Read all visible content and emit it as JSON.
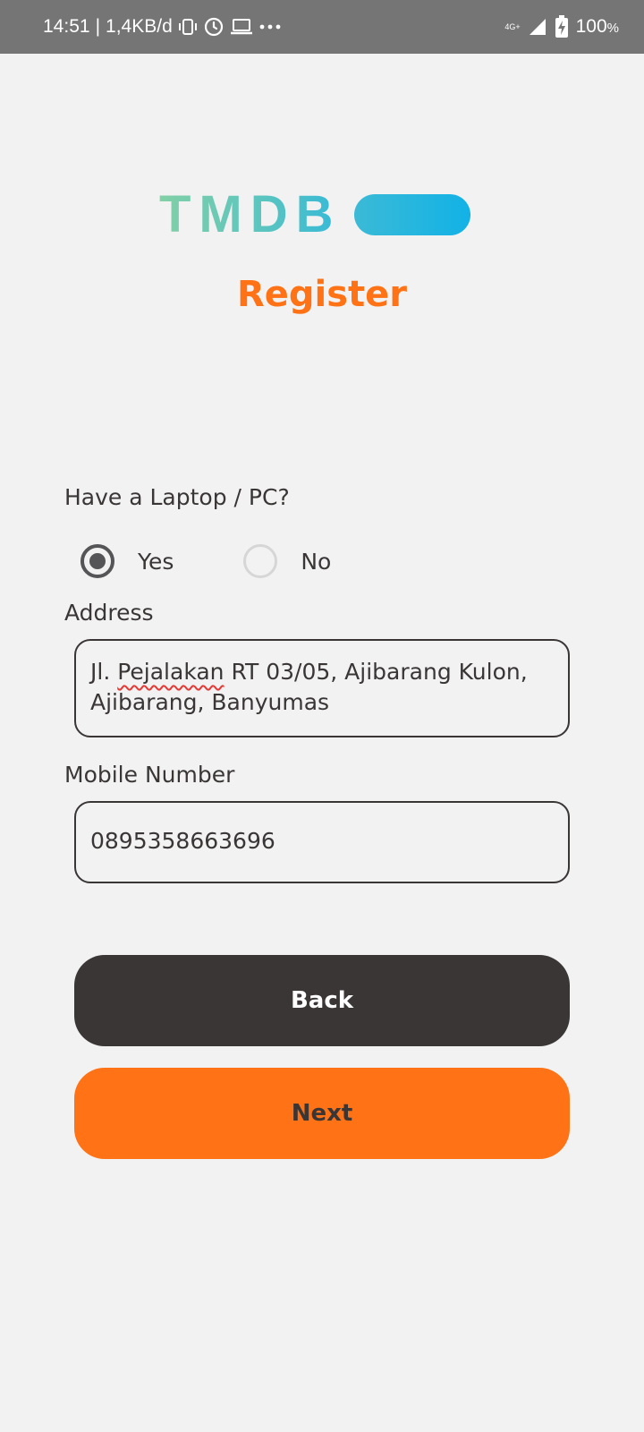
{
  "status_bar": {
    "time": "14:51",
    "separator": "|",
    "speed": "1,4KB/d",
    "network_type": "4G+",
    "battery": "100",
    "battery_unit": "%",
    "icons": [
      "vibrate-icon",
      "alarm-icon",
      "laptop-icon",
      "more-dots-icon",
      "signal-icon",
      "battery-charging-icon"
    ]
  },
  "logo": {
    "text": "TMDB"
  },
  "page": {
    "title": "Register"
  },
  "form": {
    "laptop_question": "Have a Laptop / PC?",
    "radio_options": [
      {
        "label": "Yes",
        "checked": true
      },
      {
        "label": "No",
        "checked": false
      }
    ],
    "address_label": "Address",
    "address_value_prefix": "Jl. ",
    "address_value_misspelled": "Pejalakan",
    "address_value_rest": " RT 03/05, Ajibarang Kulon, Ajibarang, Banyumas",
    "mobile_label": "Mobile Number",
    "mobile_value": "0895358663696"
  },
  "buttons": {
    "back_label": "Back",
    "next_label": "Next"
  },
  "colors": {
    "accent": "#ff7316",
    "dark": "#3a3636",
    "status_bar": "#757575",
    "background": "#f2f2f2"
  }
}
